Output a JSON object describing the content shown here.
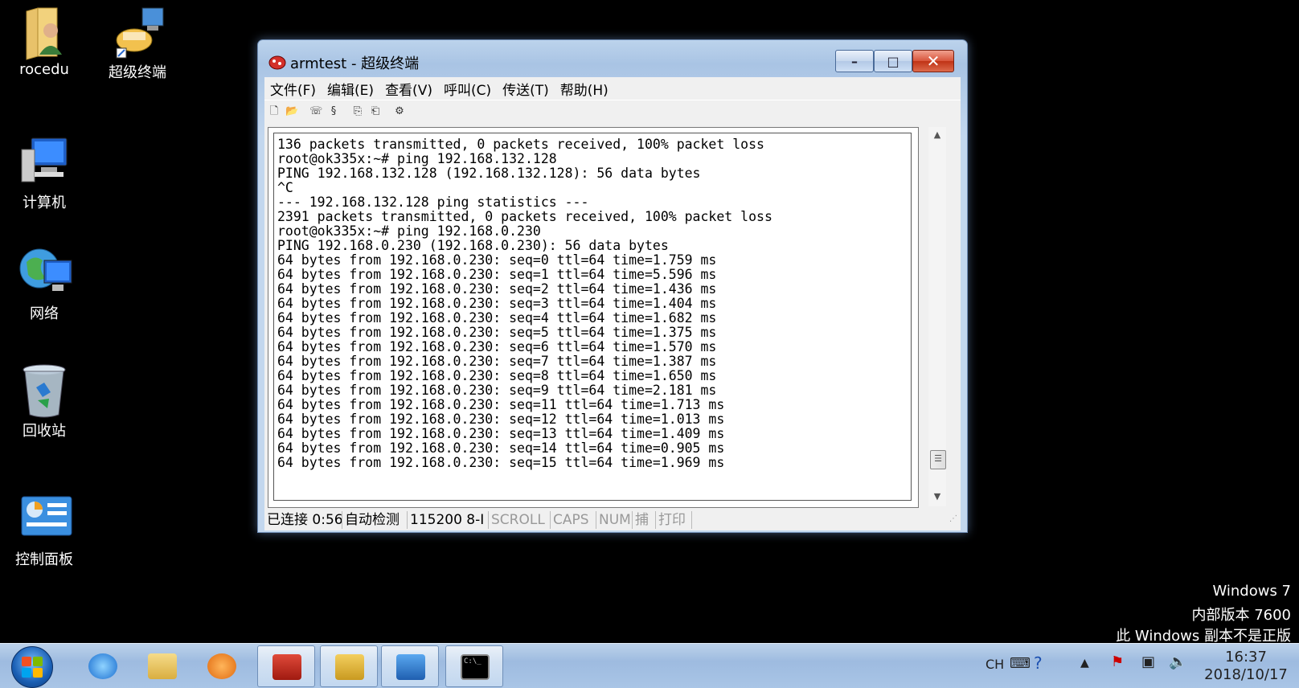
{
  "desktop": {
    "icons": [
      {
        "label": "rocedu"
      },
      {
        "label": "超级终端"
      },
      {
        "label": "计算机"
      },
      {
        "label": "网络"
      },
      {
        "label": "回收站"
      },
      {
        "label": "控制面板"
      }
    ]
  },
  "window": {
    "title": "armtest - 超级终端",
    "controls": {
      "minimize": "–",
      "maximize": "□",
      "close": "✕"
    },
    "menu": [
      "文件(F)",
      "编辑(E)",
      "查看(V)",
      "呼叫(C)",
      "传送(T)",
      "帮助(H)"
    ],
    "terminal_lines": [
      "136 packets transmitted, 0 packets received, 100% packet loss",
      "root@ok335x:~# ping 192.168.132.128",
      "PING 192.168.132.128 (192.168.132.128): 56 data bytes",
      "^C",
      "--- 192.168.132.128 ping statistics ---",
      "2391 packets transmitted, 0 packets received, 100% packet loss",
      "root@ok335x:~# ping 192.168.0.230",
      "PING 192.168.0.230 (192.168.0.230): 56 data bytes",
      "64 bytes from 192.168.0.230: seq=0 ttl=64 time=1.759 ms",
      "64 bytes from 192.168.0.230: seq=1 ttl=64 time=5.596 ms",
      "64 bytes from 192.168.0.230: seq=2 ttl=64 time=1.436 ms",
      "64 bytes from 192.168.0.230: seq=3 ttl=64 time=1.404 ms",
      "64 bytes from 192.168.0.230: seq=4 ttl=64 time=1.682 ms",
      "64 bytes from 192.168.0.230: seq=5 ttl=64 time=1.375 ms",
      "64 bytes from 192.168.0.230: seq=6 ttl=64 time=1.570 ms",
      "64 bytes from 192.168.0.230: seq=7 ttl=64 time=1.387 ms",
      "64 bytes from 192.168.0.230: seq=8 ttl=64 time=1.650 ms",
      "64 bytes from 192.168.0.230: seq=9 ttl=64 time=2.181 ms",
      "64 bytes from 192.168.0.230: seq=11 ttl=64 time=1.713 ms",
      "64 bytes from 192.168.0.230: seq=12 ttl=64 time=1.013 ms",
      "64 bytes from 192.168.0.230: seq=13 ttl=64 time=1.409 ms",
      "64 bytes from 192.168.0.230: seq=14 ttl=64 time=0.905 ms",
      "64 bytes from 192.168.0.230: seq=15 ttl=64 time=1.969 ms"
    ],
    "status": {
      "connected": "已连接 0:56",
      "detect": "自动检测",
      "baud": "115200 8-I",
      "scroll": "SCROLL",
      "caps": "CAPS",
      "num": "NUM",
      "capture": "捕",
      "print": "打印"
    }
  },
  "watermark": {
    "line1": "Windows 7",
    "line2": "内部版本 7600",
    "line3": "此 Windows 副本不是正版"
  },
  "taskbar": {
    "lang": "CH",
    "time": "16:37",
    "date": "2018/10/17"
  }
}
